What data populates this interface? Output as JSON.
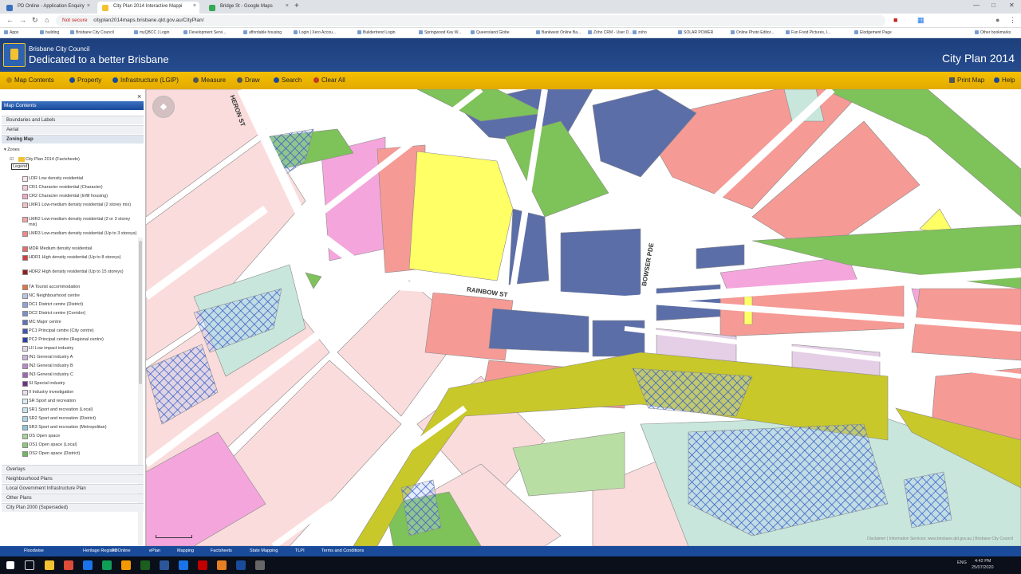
{
  "browser": {
    "tabs": [
      {
        "label": "PD Online - Application Enquiry",
        "color": "#3a6fc0"
      },
      {
        "label": "City Plan 2014 Interactive Mappi",
        "color": "#f2c230"
      },
      {
        "label": "Bridge St - Google Maps",
        "color": "#34a853"
      }
    ],
    "new_tab": "+",
    "not_secure": "Not secure",
    "url": "cityplan2014maps.brisbane.qld.gov.au/CityPlan/",
    "bookmarks": [
      "Apps",
      "building",
      "Brisbane City Council",
      "myQBCC | Login",
      "Development Servi...",
      "affordable housing",
      "Login | Xero Accou...",
      "Buildertrend Login",
      "Springwood Key W...",
      "Queensland Globe",
      "Bankwest Online Ba...",
      "Zoho CRM - User D...",
      "zoho",
      "SOLAR POWER",
      "Online Photo Editor...",
      "Fun Food Pictures, I...",
      "Elodgement Page",
      "Other bookmarks"
    ]
  },
  "header": {
    "council": "Brisbane City Council",
    "tagline": "Dedicated to a better Brisbane",
    "app_title": "City Plan 2014"
  },
  "toolbar": {
    "items": [
      {
        "label": "Map Contents",
        "name": "map-contents-button",
        "icon_color": "#b8860b"
      },
      {
        "label": "Property",
        "name": "property-button",
        "icon_color": "#1a4b9a"
      },
      {
        "label": "Infrastructure (LGIP)",
        "name": "infrastructure-button",
        "icon_color": "#1a4b9a"
      },
      {
        "label": "Measure",
        "name": "measure-button",
        "icon_color": "#555"
      },
      {
        "label": "Draw",
        "name": "draw-button",
        "icon_color": "#555"
      },
      {
        "label": "Search",
        "name": "search-button",
        "icon_color": "#1a4b9a"
      },
      {
        "label": "Clear All",
        "name": "clear-all-button",
        "icon_color": "#c0392b"
      }
    ],
    "print": "Print Map",
    "help": "Help"
  },
  "sidebar": {
    "title": "Map Contents",
    "close": "×",
    "sections_top": [
      "Boundaries and Labels",
      "Aerial",
      "Zoning Map"
    ],
    "zones_header": "Zones",
    "layer": "City Plan 2014 (Factsheets)",
    "legend": "Legend",
    "zones": [
      {
        "label": "LDR Low density residential",
        "color": "#fde6ea"
      },
      {
        "label": "CR1 Character residential (Character)",
        "color": "#f7c8d8"
      },
      {
        "label": "CR2 Character residential (Infill housing)",
        "color": "#f3a8c8"
      },
      {
        "label": "LMR1 Low-medium density residential (2 storey mix)",
        "color": "#f8c0c0"
      },
      {
        "label": "LMR2 Low-medium density residential (2 or 3 storey mix)",
        "color": "#f5a4a4"
      },
      {
        "label": "LMR3 Low-medium density residential (Up to 3 storeys)",
        "color": "#f08888"
      },
      {
        "label": "MDR Medium density residential",
        "color": "#ea6a6a"
      },
      {
        "label": "HDR1 High density residential (Up to 8 storeys)",
        "color": "#d43c3c"
      },
      {
        "label": "HDR2 High density residential (Up to 15 storeys)",
        "color": "#9b1b1b"
      },
      {
        "label": "TA Tourist accommodation",
        "color": "#e8743c"
      },
      {
        "label": "NC Neighbourhood centre",
        "color": "#b7c6e6"
      },
      {
        "label": "DC1 District centre (District)",
        "color": "#8fa3d6"
      },
      {
        "label": "DC2 District centre (Corridor)",
        "color": "#7a8fcc"
      },
      {
        "label": "MC Major centre",
        "color": "#5c73c0"
      },
      {
        "label": "PC1 Principal centre (City centre)",
        "color": "#3d55b3"
      },
      {
        "label": "PC2 Principal centre (Regional centre)",
        "color": "#2a40a8"
      },
      {
        "label": "LII Low impact industry",
        "color": "#e4d6ec"
      },
      {
        "label": "IN1 General industry A",
        "color": "#cfb2de"
      },
      {
        "label": "IN2 General industry B",
        "color": "#b88ccc"
      },
      {
        "label": "IN3 General industry C",
        "color": "#9f66b8"
      },
      {
        "label": "SI Special industry",
        "color": "#6f2f8f"
      },
      {
        "label": "II Industry investigation",
        "color": "#eadff0"
      },
      {
        "label": "SR Sport and recreation",
        "color": "#d6ecf4"
      },
      {
        "label": "SR1 Sport and recreation (Local)",
        "color": "#c4e3ef"
      },
      {
        "label": "SR2 Sport and recreation (District)",
        "color": "#a9d5e6"
      },
      {
        "label": "SR3 Sport and recreation (Metropolitan)",
        "color": "#8ac6dc"
      },
      {
        "label": "OS Open space",
        "color": "#a6d596"
      },
      {
        "label": "OS1 Open space (Local)",
        "color": "#8cc97a"
      },
      {
        "label": "OS2 Open space (District)",
        "color": "#6db85a"
      },
      {
        "label": "OS3 Open space (Metropolitan)",
        "color": "#4ea43c"
      }
    ],
    "sections_bottom": [
      "Overlays",
      "Neighbourhood Plans",
      "Local Government Infrastructure Plan",
      "Other Plans",
      "City Plan 2000 (Superseded)"
    ]
  },
  "map": {
    "streets": [
      "HERON ST",
      "RAINBOW ST",
      "BOWSER PDE"
    ],
    "zone_colors": {
      "ldr": "#fbdcdc",
      "lmr": "#f59a95",
      "cr": "#f4a6dc",
      "centre": "#5c6ea8",
      "open_space": "#7ec25a",
      "open_space_light": "#b9dea4",
      "sport": "#c8e6dc",
      "commercial_yellow": "#ffff66",
      "olive": "#c8c82a",
      "lilac": "#e4cfe6",
      "hatch": "#2a56c8"
    },
    "copyright": "Disclaimer | Information Services: www.brisbane.qld.gov.au | Brisbane City Council"
  },
  "footer": {
    "links": [
      "Floodwise",
      "Heritage Register",
      "PDOnline",
      "ePlan",
      "Mapping",
      "Factsheets",
      "State Mapping",
      "TLPI",
      "Terms and Conditions"
    ]
  },
  "taskbar": {
    "tray": "ENG",
    "time": "4:42 PM",
    "date": "25/07/2020"
  }
}
